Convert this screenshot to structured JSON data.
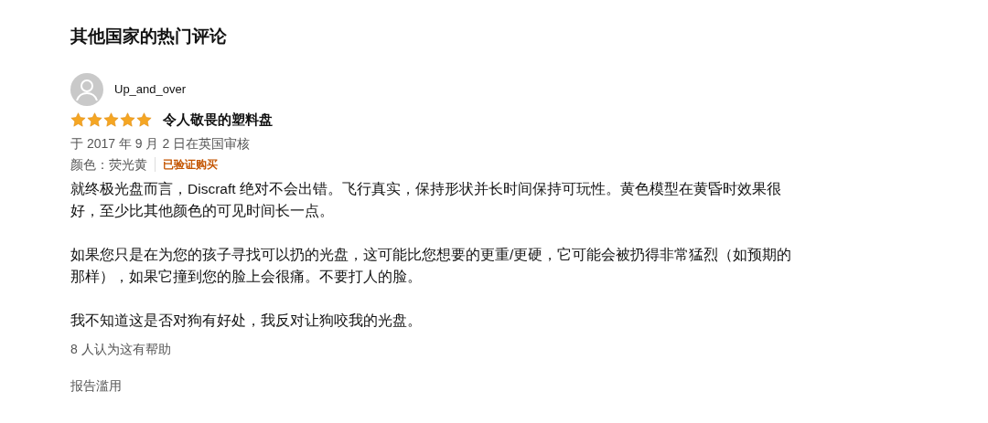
{
  "section_title": "其他国家的热门评论",
  "review": {
    "author": "Up_and_over",
    "stars": 5,
    "title": "令人敬畏的塑料盘",
    "date": "于 2017 年 9 月 2 日在英国审核",
    "variant": "颜色：荧光黄",
    "verified": "已验证购买",
    "paragraphs": [
      "就终极光盘而言，Discraft 绝对不会出错。飞行真实，保持形状并长时间保持可玩性。黄色模型在黄昏时效果很好，至少比其他颜色的可见时间长一点。",
      "如果您只是在为您的孩子寻找可以扔的光盘，这可能比您想要的更重/更硬，它可能会被扔得非常猛烈（如预期的那样），如果它撞到您的脸上会很痛。不要打人的脸。",
      "我不知道这是否对狗有好处，我反对让狗咬我的光盘。"
    ],
    "helpful": "8 人认为这有帮助",
    "report": "报告滥用"
  }
}
